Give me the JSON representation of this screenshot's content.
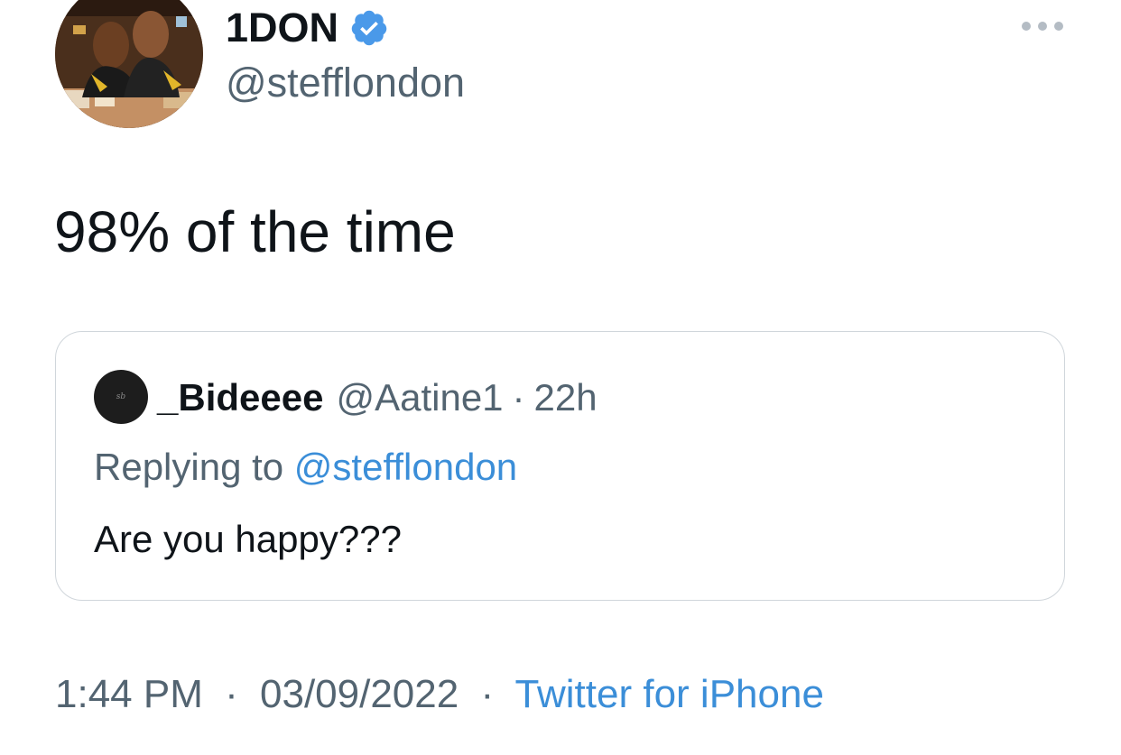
{
  "author": {
    "display_name": "1DON",
    "handle": "@stefflondon",
    "verified": true,
    "avatar_icon": "profile-photo"
  },
  "tweet": {
    "text": "98% of the time",
    "time": "1:44 PM",
    "separator": "·",
    "date": "03/09/2022",
    "source": "Twitter for iPhone"
  },
  "quoted_tweet": {
    "display_name": "_Bideeee",
    "handle": "@Aatine1",
    "separator": "·",
    "age": "22h",
    "replying_label": "Replying to",
    "replying_to": "@stefflondon",
    "text": "Are you happy???"
  },
  "menu": {
    "icon": "more-horizontal-icon"
  },
  "colors": {
    "accent": "#3b8ed8",
    "verified_badge": "#4a99e9",
    "secondary_text": "#536471",
    "border": "#d0d6db"
  }
}
